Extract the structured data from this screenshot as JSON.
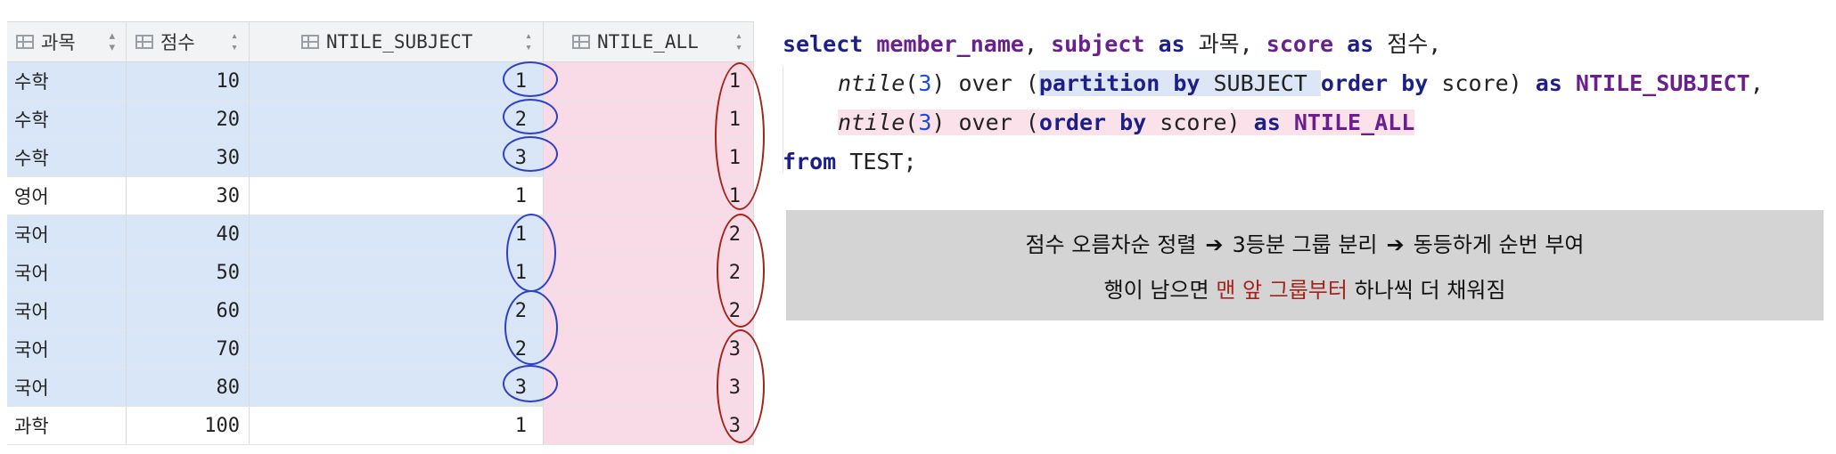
{
  "grid": {
    "columns": [
      {
        "name": "과목"
      },
      {
        "name": "점수"
      },
      {
        "name": "NTILE_SUBJECT"
      },
      {
        "name": "NTILE_ALL"
      }
    ],
    "rows": [
      [
        "수학",
        "10",
        "1",
        "1"
      ],
      [
        "수학",
        "20",
        "2",
        "1"
      ],
      [
        "수학",
        "30",
        "3",
        "1"
      ],
      [
        "영어",
        "30",
        "1",
        "1"
      ],
      [
        "국어",
        "40",
        "1",
        "2"
      ],
      [
        "국어",
        "50",
        "1",
        "2"
      ],
      [
        "국어",
        "60",
        "2",
        "2"
      ],
      [
        "국어",
        "70",
        "2",
        "3"
      ],
      [
        "국어",
        "80",
        "3",
        "3"
      ],
      [
        "과학",
        "100",
        "1",
        "3"
      ]
    ],
    "highlight_colors": {
      "subject_rows": "#d8e6f7",
      "ntile_all_column": "#f8dbe6"
    },
    "annotation_colors": {
      "blue": "#2f3fc7",
      "red": "#a4231b"
    }
  },
  "sql": {
    "line1": {
      "select": "select",
      "member_name": "member_name",
      "comma1": ", ",
      "subject": "subject",
      "as1": " as ",
      "kr_subject": "과목",
      "comma2": ", ",
      "score": "score",
      "as2": " as ",
      "kr_score": "점수",
      "comma3": ","
    },
    "line2": {
      "ntile": "ntile",
      "open": "(",
      "n": "3",
      "close": ")",
      "over": " over (",
      "partition_by": "partition by",
      "subject_col": " SUBJECT ",
      "order_by": "order by",
      "score": " score) ",
      "as": "as",
      "alias": " NTILE_SUBJECT",
      "comma": ","
    },
    "line3": {
      "ntile": "ntile",
      "open": "(",
      "n": "3",
      "close": ")",
      "over": " over (",
      "order_by": "order by",
      "score": " score) ",
      "as": "as",
      "alias": " NTILE_ALL"
    },
    "line4": {
      "from": "from",
      "rest": " TEST;"
    }
  },
  "note": {
    "line1_part1": "점수 오름차순 정렬",
    "line1_part2": "3등분 그룹 분리",
    "line1_part3": "동등하게 순번 부여",
    "arrow": "➔",
    "line2_before": "행이 남으면 ",
    "line2_accent": "맨 앞 그룹부터",
    "line2_after": " 하나씩 더 채워짐",
    "accent_color": "#a4231b"
  }
}
